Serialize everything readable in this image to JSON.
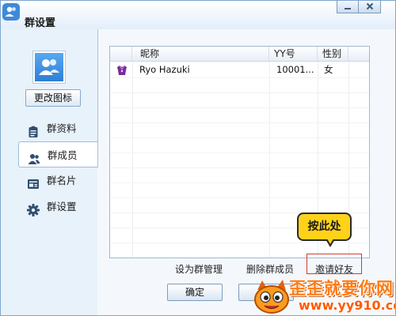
{
  "window": {
    "title": "群设置",
    "controls": {
      "minimize_icon": "minimize-icon",
      "close_icon": "close-icon"
    }
  },
  "sidebar": {
    "avatar_icon": "group-avatar-icon",
    "change_icon_label": "更改图标",
    "items": [
      {
        "label": "群资料",
        "icon": "clipboard-icon",
        "active": false
      },
      {
        "label": "群成员",
        "icon": "members-icon",
        "active": true
      },
      {
        "label": "群名片",
        "icon": "card-icon",
        "active": false
      },
      {
        "label": "群设置",
        "icon": "gear-icon",
        "active": false
      }
    ]
  },
  "members_table": {
    "columns": [
      "昵称",
      "YY号",
      "性别"
    ],
    "rows": [
      {
        "icon": "vip-user-icon",
        "nickname": "Ryo Hazuki",
        "yy": "10001...",
        "gender": "女"
      }
    ]
  },
  "actions": {
    "set_admin": "设为群管理",
    "remove_member": "删除群成员",
    "invite_friend": "邀请好友"
  },
  "tooltip": {
    "text": "按此处"
  },
  "buttons": {
    "ok": "确定",
    "cancel": ""
  },
  "watermark": {
    "title": "歪歪就要你网",
    "url": "www.yy910.com"
  },
  "colors": {
    "accent": "#3f8ad8",
    "highlight_border": "#d43a2e",
    "tooltip_bg": "#ffd21a",
    "watermark": "#ff7a14"
  }
}
